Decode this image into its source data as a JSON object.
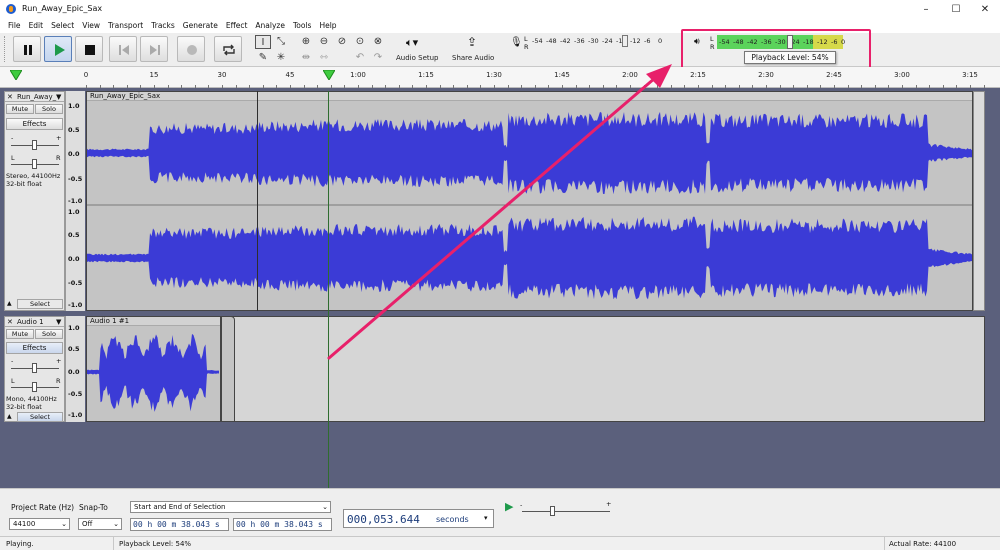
{
  "window": {
    "title": "Run_Away_Epic_Sax",
    "minimize": "–",
    "maximize": "☐",
    "close": "✕"
  },
  "menu": [
    "File",
    "Edit",
    "Select",
    "View",
    "Transport",
    "Tracks",
    "Generate",
    "Effect",
    "Analyze",
    "Tools",
    "Help"
  ],
  "toolbar": {
    "audio_setup_label": "Audio Setup",
    "share_audio_label": "Share Audio",
    "record_meter_scale": [
      "-54",
      "-48",
      "-42",
      "-36",
      "-30",
      "-24",
      "-18",
      "-12",
      "-6",
      "0"
    ],
    "playback_meter_scale": [
      "-54",
      "-48",
      "-42",
      "-36",
      "-30",
      "-24",
      "-18",
      "-12",
      "-6",
      "0"
    ],
    "meter_channels": [
      "L",
      "R"
    ],
    "tooltip": "Playback Level: 54%",
    "playback_level_percent": 54
  },
  "timeline": {
    "labels": [
      "0",
      "15",
      "30",
      "45",
      "1:00",
      "1:15",
      "1:30",
      "1:45",
      "2:00",
      "2:15",
      "2:30",
      "2:45",
      "3:00",
      "3:15"
    ]
  },
  "tracks": [
    {
      "name": "Run_Away_",
      "clip_name": "Run_Away_Epic_Sax",
      "mute": "Mute",
      "solo": "Solo",
      "effects": "Effects",
      "gain_minus": "-",
      "gain_plus": "+",
      "pan_left": "L",
      "pan_right": "R",
      "info_line1": "Stereo, 44100Hz",
      "info_line2": "32-bit float",
      "select": "Select",
      "ruler": [
        "1.0",
        "0.5",
        "0.0",
        "-0.5",
        "-1.0"
      ]
    },
    {
      "name": "Audio 1",
      "clip_name": "Audio 1 #1",
      "mute": "Mute",
      "solo": "Solo",
      "effects": "Effects",
      "gain_minus": "-",
      "gain_plus": "+",
      "pan_left": "L",
      "pan_right": "R",
      "info_line1": "Mono, 44100Hz",
      "info_line2": "32-bit float",
      "select": "Select",
      "ruler": [
        "1.0",
        "0.5",
        "0.0",
        "-0.5",
        "-1.0"
      ]
    }
  ],
  "bottom": {
    "project_rate_label": "Project Rate (Hz)",
    "project_rate_value": "44100",
    "snap_to_label": "Snap-To",
    "snap_to_value": "Off",
    "selection_mode": "Start and End of Selection",
    "selection_start": "00 h 00 m 38.043 s",
    "selection_end": "00 h 00 m 38.043 s",
    "time_display": "000,053.644",
    "time_unit": "seconds",
    "speed_minus": "-",
    "speed_plus": "+"
  },
  "status": {
    "state": "Playing.",
    "message": "Playback Level: 54%",
    "actual_rate": "Actual Rate: 44100"
  },
  "colors": {
    "wave": "#3b3bd6",
    "wave_rms": "#6a6aee",
    "highlight": "#e8206a",
    "track_bg": "#5b607c"
  }
}
